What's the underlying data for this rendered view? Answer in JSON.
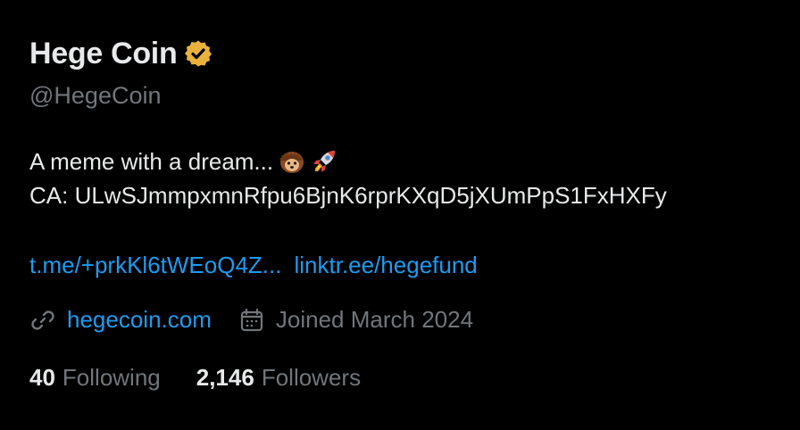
{
  "profile": {
    "display_name": "Hege Coin",
    "handle": "@HegeCoin",
    "verified_badge_color": "#e9b23c",
    "verified_icon": "verified-check-icon"
  },
  "bio": {
    "line1_text": "A meme with a dream... ",
    "line1_emojis": [
      "hedgehog-emoji",
      "rocket-emoji"
    ],
    "line2_text": "CA: ULwSJmmpxmnRfpu6BjnK6rprKXqD5jXUmPpS1FxHXFy"
  },
  "links": {
    "telegram": "t.me/+prkKl6tWEoQ4Z...",
    "linktree": "linktr.ee/hegefund"
  },
  "meta": {
    "website_icon": "link-icon",
    "website": "hegecoin.com",
    "joined_icon": "calendar-icon",
    "joined": "Joined March 2024"
  },
  "stats": {
    "following_count": "40",
    "following_label": "Following",
    "followers_count": "2,146",
    "followers_label": "Followers"
  },
  "colors": {
    "background": "#000000",
    "primary_text": "#e7e9ea",
    "secondary_text": "#71767b",
    "link": "#1d9bf0"
  }
}
